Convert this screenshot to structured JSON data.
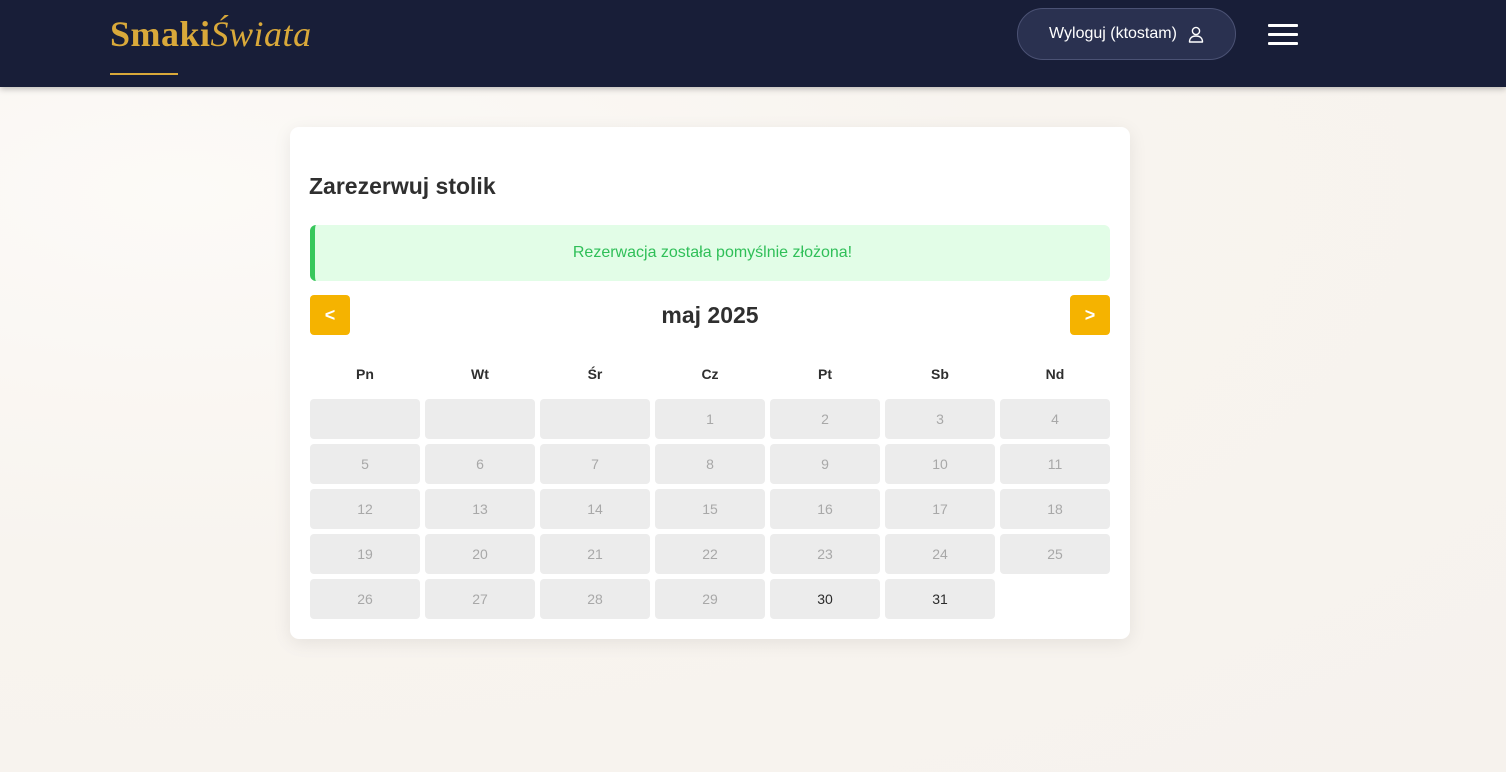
{
  "brand": {
    "part1": "Smaki",
    "part2": "Świata"
  },
  "header": {
    "logout_label": "Wyloguj (ktostam)",
    "user_icon": "user-icon",
    "menu_icon": "hamburger-menu-icon"
  },
  "colors": {
    "navbar": "#181e38",
    "brand_gold": "#d9a93a",
    "accent": "#f5b300",
    "success_bg": "#e2fde7",
    "success_text": "#2fbf58",
    "day_bg": "#ececec"
  },
  "reservation": {
    "title": "Zarezerwuj stolik",
    "success_message": "Rezerwacja została pomyślnie złożona!",
    "prev_label": "<",
    "next_label": ">",
    "month_label": "maj 2025",
    "weekdays": [
      "Pn",
      "Wt",
      "Śr",
      "Cz",
      "Pt",
      "Sb",
      "Nd"
    ],
    "leading_empty_days": 3,
    "days": [
      {
        "day": "1",
        "available": false
      },
      {
        "day": "2",
        "available": false
      },
      {
        "day": "3",
        "available": false
      },
      {
        "day": "4",
        "available": false
      },
      {
        "day": "5",
        "available": false
      },
      {
        "day": "6",
        "available": false
      },
      {
        "day": "7",
        "available": false
      },
      {
        "day": "8",
        "available": false
      },
      {
        "day": "9",
        "available": false
      },
      {
        "day": "10",
        "available": false
      },
      {
        "day": "11",
        "available": false
      },
      {
        "day": "12",
        "available": false
      },
      {
        "day": "13",
        "available": false
      },
      {
        "day": "14",
        "available": false
      },
      {
        "day": "15",
        "available": false
      },
      {
        "day": "16",
        "available": false
      },
      {
        "day": "17",
        "available": false
      },
      {
        "day": "18",
        "available": false
      },
      {
        "day": "19",
        "available": false
      },
      {
        "day": "20",
        "available": false
      },
      {
        "day": "21",
        "available": false
      },
      {
        "day": "22",
        "available": false
      },
      {
        "day": "23",
        "available": false
      },
      {
        "day": "24",
        "available": false
      },
      {
        "day": "25",
        "available": false
      },
      {
        "day": "26",
        "available": false
      },
      {
        "day": "27",
        "available": false
      },
      {
        "day": "28",
        "available": false
      },
      {
        "day": "29",
        "available": false
      },
      {
        "day": "30",
        "available": true
      },
      {
        "day": "31",
        "available": true
      }
    ]
  }
}
